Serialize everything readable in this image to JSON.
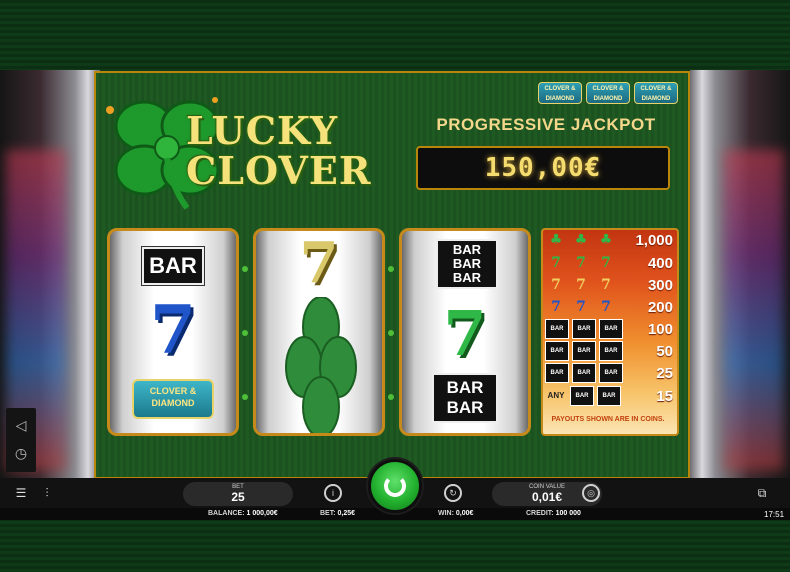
{
  "game": {
    "logo_line1": "LUCKY",
    "logo_line2": "CLOVER"
  },
  "jackpot": {
    "title": "PROGRESSIVE JACKPOT",
    "value": "150,00€",
    "mini_badges": [
      "CLOVER & DIAMOND",
      "CLOVER & DIAMOND",
      "CLOVER & DIAMOND"
    ]
  },
  "reels": [
    {
      "top": "BAR",
      "middle": "7",
      "bottom": "CLOVER & DIAMOND"
    },
    {
      "top": "7",
      "middle": "clover-leaf",
      "bottom": "clover-leaf"
    },
    {
      "top": "BAR BAR BAR",
      "middle": "7",
      "bottom": "BAR BAR"
    }
  ],
  "paytable": {
    "rows": [
      {
        "symbols": "3x clover",
        "payout": "1,000"
      },
      {
        "symbols": "3x green 7",
        "payout": "400"
      },
      {
        "symbols": "3x gold 7",
        "payout": "300"
      },
      {
        "symbols": "3x blue 7",
        "payout": "200"
      },
      {
        "symbols": "3x triple bar",
        "payout": "100"
      },
      {
        "symbols": "3x double bar",
        "payout": "50"
      },
      {
        "symbols": "3x bar",
        "payout": "25"
      },
      {
        "symbols": "any bar",
        "payout": "15",
        "any_label": "ANY"
      }
    ],
    "note": "PAYOUTS SHOWN ARE IN COINS.",
    "bar_text": "BAR"
  },
  "controls": {
    "bet_label": "BET",
    "bet_value": "25",
    "coin_value_label": "COIN VALUE",
    "coin_value": "0,01€"
  },
  "status": {
    "balance_label": "BALANCE:",
    "balance_value": "1 000,00€",
    "bet_label": "BET:",
    "bet_value": "0,25€",
    "win_label": "WIN:",
    "win_value": "0,00€",
    "credit_label": "CREDIT:",
    "credit_value": "100 000",
    "clock": "17:51"
  },
  "colors": {
    "felt_green": "#1f5a23",
    "gold": "#b8860b",
    "jackpot_text": "#f5dc6e",
    "spin_green": "#22b02e"
  }
}
